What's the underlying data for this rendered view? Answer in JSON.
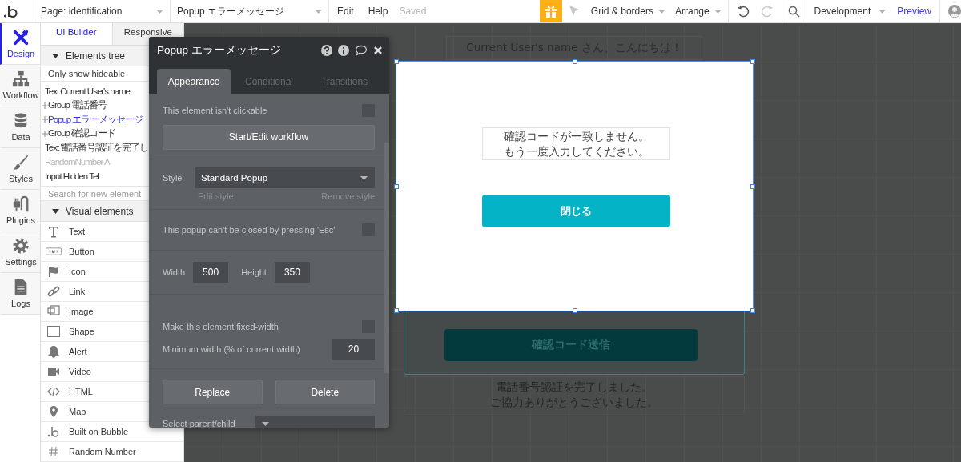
{
  "top_bar": {
    "page_selector": "Page: identification",
    "element_selector": "Popup エラーメッセージ",
    "menu": [
      {
        "label": "Edit"
      },
      {
        "label": "Help"
      }
    ],
    "save_status": "Saved",
    "grid_menu": "Grid & borders",
    "arrange_menu": "Arrange",
    "version_menu": "Development",
    "preview_link": "Preview"
  },
  "nav": [
    {
      "label": "Design",
      "selected": true
    },
    {
      "label": "Workflow",
      "selected": false
    },
    {
      "label": "Data",
      "selected": false
    },
    {
      "label": "Styles",
      "selected": false
    },
    {
      "label": "Plugins",
      "selected": false
    },
    {
      "label": "Settings",
      "selected": false
    },
    {
      "label": "Logs",
      "selected": false
    }
  ],
  "panel": {
    "tabs": [
      {
        "label": "UI Builder",
        "selected": true
      },
      {
        "label": "Responsive",
        "selected": false
      }
    ],
    "elements_tree": {
      "title": "Elements tree",
      "expanded": true,
      "filter": "Only show hideable",
      "items": [
        {
          "label": "Text Current User's name",
          "expandable": false,
          "selected": false,
          "hidden": false
        },
        {
          "label": "Group 電話番号",
          "expandable": true,
          "selected": false,
          "hidden": false
        },
        {
          "label": "Popup エラーメッセージ",
          "expandable": true,
          "selected": true,
          "hidden": false
        },
        {
          "label": "Group 確認コード",
          "expandable": true,
          "selected": false,
          "hidden": false
        },
        {
          "label": "Text 電話番号認証を完了し",
          "expandable": false,
          "selected": false,
          "hidden": false
        },
        {
          "label": "RandomNumber A",
          "expandable": false,
          "selected": false,
          "hidden": true
        },
        {
          "label": "Input Hidden Tel",
          "expandable": false,
          "selected": false,
          "hidden": false
        }
      ]
    },
    "search": {
      "placeholder": "Search for new element"
    },
    "visual_elements": {
      "title": "Visual elements",
      "expanded": true,
      "items": [
        {
          "label": "Text"
        },
        {
          "label": "Button"
        },
        {
          "label": "Icon"
        },
        {
          "label": "Link"
        },
        {
          "label": "Image"
        },
        {
          "label": "Shape"
        },
        {
          "label": "Alert"
        },
        {
          "label": "Video"
        },
        {
          "label": "HTML"
        },
        {
          "label": "Map"
        },
        {
          "label": "Built on Bubble"
        },
        {
          "label": "Random Number"
        }
      ]
    }
  },
  "property_editor": {
    "title": "Popup エラーメッセージ",
    "tabs": [
      {
        "label": "Appearance",
        "selected": true
      },
      {
        "label": "Conditional",
        "selected": false
      },
      {
        "label": "Transitions",
        "selected": false
      }
    ],
    "sections": [
      [
        {
          "kind": "checkbox",
          "label": "This element isn't clickable",
          "checked": false
        },
        {
          "kind": "button",
          "label": "Start/Edit workflow"
        }
      ],
      [
        {
          "kind": "select",
          "label": "Style",
          "value": "Standard Popup",
          "links": [
            "Edit style",
            "Remove style"
          ]
        }
      ],
      [
        {
          "kind": "checkbox",
          "label": "This popup can't be closed by pressing 'Esc'",
          "checked": false
        }
      ],
      [
        {
          "kind": "size",
          "items": [
            {
              "label": "Width",
              "value": "500"
            },
            {
              "label": "Height",
              "value": "350"
            }
          ]
        }
      ],
      [
        {
          "kind": "checkbox",
          "label": "Make this element fixed-width",
          "checked": false
        },
        {
          "kind": "number",
          "label": "Minimum width (% of current width)",
          "value": "20"
        }
      ],
      [
        {
          "kind": "buttons",
          "items": [
            "Replace",
            "Delete"
          ]
        },
        {
          "kind": "select",
          "label": "Select parent/child"
        }
      ]
    ]
  },
  "canvas": {
    "greeting": "Current User's name さん、こんにちは！",
    "popup": {
      "selected": true,
      "message_lines": [
        "確認コードが一致しません。",
        "もう一度入力してください。"
      ],
      "close_button": "閉じる"
    },
    "send_button": "確認コード送信",
    "completion_lines": [
      "電話番号認証を完了しました。",
      "ご協力ありがとうございました。"
    ]
  }
}
